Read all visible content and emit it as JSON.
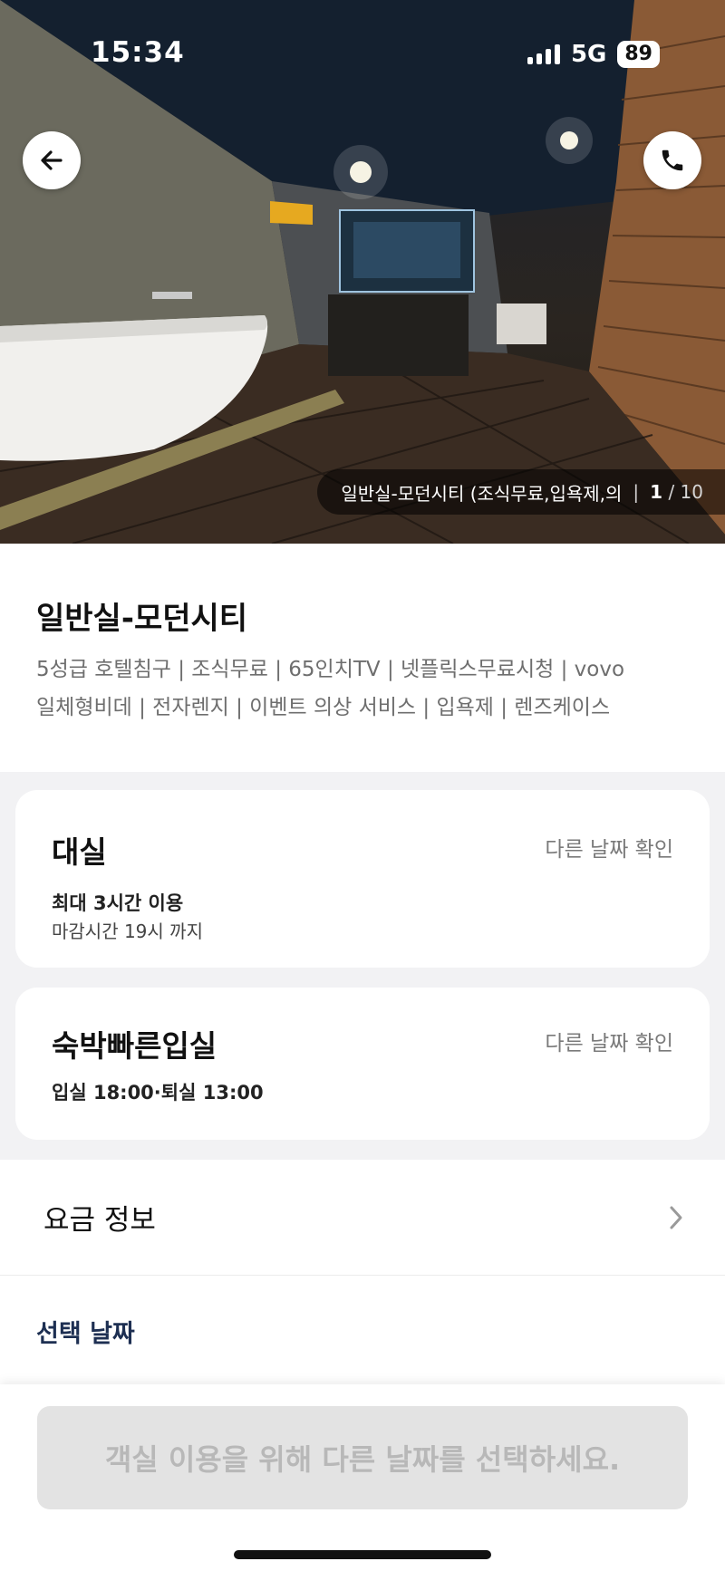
{
  "status_bar": {
    "time": "15:34",
    "network": "5G",
    "battery": "89"
  },
  "hero": {
    "back_icon": "arrow-left-icon",
    "call_icon": "phone-icon",
    "caption": "일반실-모던시티 (조식무료,입욕제,의",
    "index_current": "1",
    "index_total": "/ 10"
  },
  "room": {
    "title": "일반실-모던시티",
    "description_line1": "5성급 호텔침구 | 조식무료 | 65인치TV | 넷플릭스무료시청 | vovo",
    "description_line2": "일체형비데 | 전자렌지 | 이벤트 의상 서비스 | 입욕제 | 렌즈케이스"
  },
  "offers": [
    {
      "name": "대실",
      "link": "다른 날짜 확인",
      "line1": "최대 3시간 이용",
      "line2": "마감시간 19시 까지"
    },
    {
      "name": "숙박빠른입실",
      "link": "다른 날짜 확인",
      "line1": "입실 18:00·퇴실 13:00"
    }
  ],
  "rate_info": {
    "label": "요금 정보",
    "icon": "chevron-right-icon"
  },
  "select_date": {
    "label": "선택 날짜"
  },
  "cta": {
    "label": "객실 이용을 위해 다른 날짜를 선택하세요."
  },
  "colors": {
    "accent_navy": "#1d2f52",
    "cta_bg": "#e3e3e3",
    "cta_text": "#b8b8b8",
    "section_grey": "#f2f2f4"
  }
}
